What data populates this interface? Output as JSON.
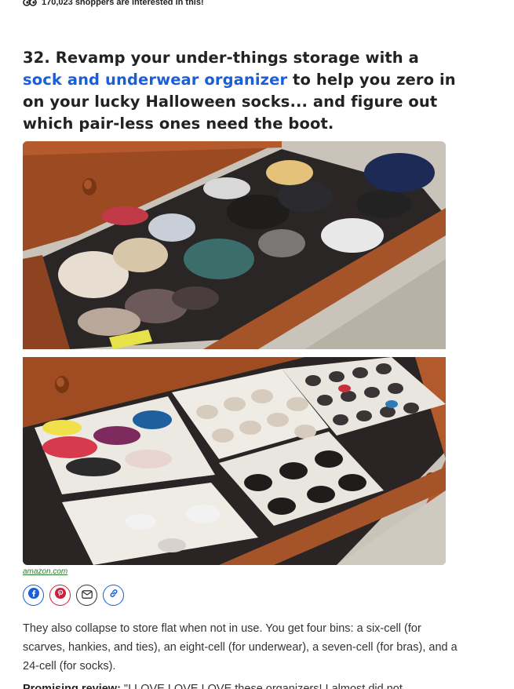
{
  "interest": {
    "icon": "eyes-icon",
    "text": "170,023 shoppers are interested in this!"
  },
  "item": {
    "number_prefix": "32. Revamp your under-things storage with a ",
    "link_text": "sock and underwear organizer",
    "headline_suffix": " to help you zero in on your lucky Halloween socks... and figure out which pair-less ones need the boot.",
    "link_color": "#1a5fd4"
  },
  "source": {
    "label": "amazon.com"
  },
  "share": {
    "buttons": [
      "facebook-icon",
      "pinterest-icon",
      "mail-icon",
      "link-icon"
    ],
    "colors": {
      "facebook": "#1a5fd4",
      "pinterest": "#cc1f3d",
      "mail": "#333333",
      "link": "#1a5fd4"
    }
  },
  "body": {
    "paragraph": "They also collapse to store flat when not in use. You get four bins: a six-cell (for scarves, hankies, and ties), an eight-cell (for underwear), a seven-cell (for bras), and a 24-cell (for socks).",
    "review_label": "Promising review:",
    "review_text": " \"I LOVE LOVE LOVE these organizers! I almost did not"
  }
}
